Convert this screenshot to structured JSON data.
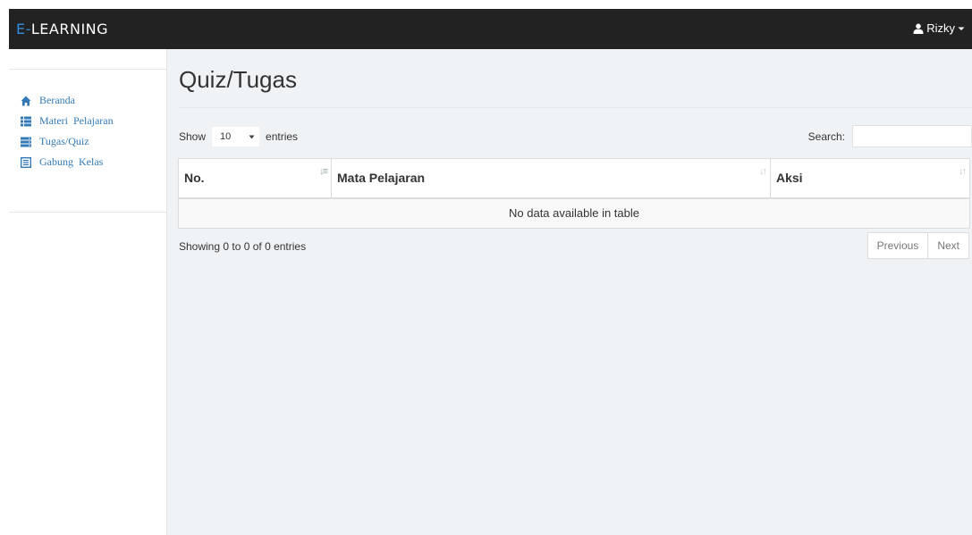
{
  "app": {
    "brand_prefix": "E-",
    "brand_rest": "LEARNING",
    "accent_color": "#2f8fe0",
    "navbar_color": "#222222"
  },
  "user": {
    "name": "Rizky",
    "icon": "user-icon",
    "dropdown_icon": "caret-down-icon"
  },
  "sidebar": {
    "items": [
      {
        "label": "Beranda",
        "icon": "home-icon"
      },
      {
        "label": "Materi  Pelajaran",
        "icon": "list-icon"
      },
      {
        "label": "Tugas/Quiz",
        "icon": "server-icon"
      },
      {
        "label": "Gabung  Kelas",
        "icon": "list-alt-icon"
      }
    ]
  },
  "page": {
    "title": "Quiz/Tugas"
  },
  "table_controls": {
    "show_label": "Show",
    "entries_value": "10",
    "entries_label": "entries",
    "search_label": "Search:",
    "search_value": ""
  },
  "table": {
    "columns": [
      "No.",
      "Mata Pelajaran",
      "Aksi"
    ],
    "empty_message": "No data available in table",
    "info": "Showing 0 to 0 of 0 entries"
  },
  "pagination": {
    "previous": "Previous",
    "next": "Next"
  }
}
